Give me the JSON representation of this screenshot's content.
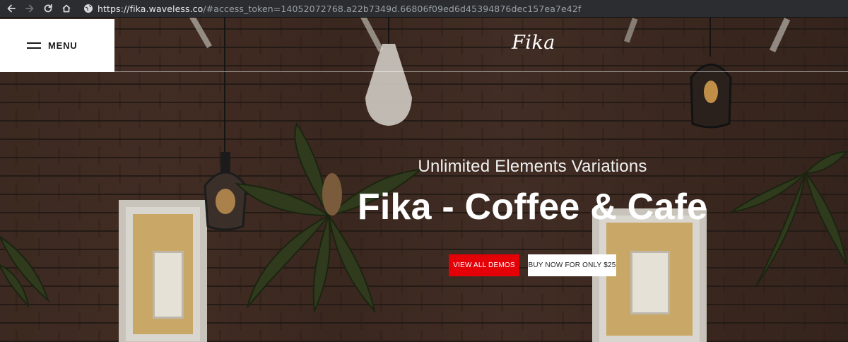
{
  "browser": {
    "url_domain": "https://fika.waveless.co",
    "url_rest": "/#access_token=14052072768.a22b7349d.66806f09ed6d45394876dec157ea7e42f"
  },
  "header": {
    "menu_label": "MENU",
    "logo_text": "Fika"
  },
  "hero": {
    "subtitle": "Unlimited Elements Variations",
    "title": "Fika - Coffee & Cafe",
    "buttons": {
      "demos_label": "VIEW ALL DEMOS",
      "buy_label": "BUY NOW FOR ONLY $25"
    }
  },
  "colors": {
    "accent_red": "#e30007",
    "menu_bg": "#ffffff",
    "browser_bar": "#2b2d31"
  },
  "icons": {
    "back": "arrow-left-icon",
    "forward": "arrow-right-icon",
    "reload": "reload-icon",
    "home": "home-icon",
    "site": "globe-icon",
    "menu": "hamburger-icon"
  }
}
